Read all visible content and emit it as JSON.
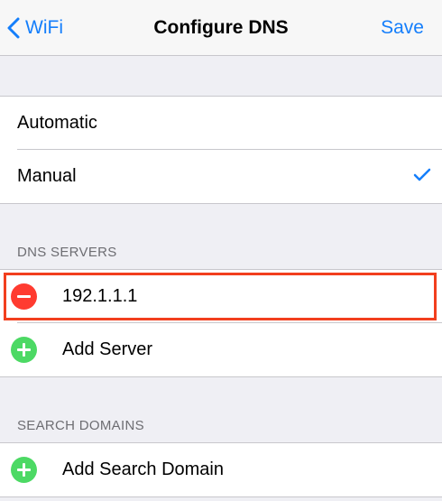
{
  "navbar": {
    "back_label": "WiFi",
    "title": "Configure DNS",
    "save_label": "Save",
    "accent_color": "#147efb"
  },
  "mode_group": {
    "options": [
      {
        "label": "Automatic",
        "selected": false
      },
      {
        "label": "Manual",
        "selected": true
      }
    ]
  },
  "dns_servers": {
    "header": "DNS SERVERS",
    "servers": [
      {
        "address": "192.1.1.1",
        "icon": "remove-icon"
      }
    ],
    "add_label": "Add Server",
    "highlight_color": "#f23f1e"
  },
  "search_domains": {
    "header": "SEARCH DOMAINS",
    "add_label": "Add Search Domain"
  }
}
